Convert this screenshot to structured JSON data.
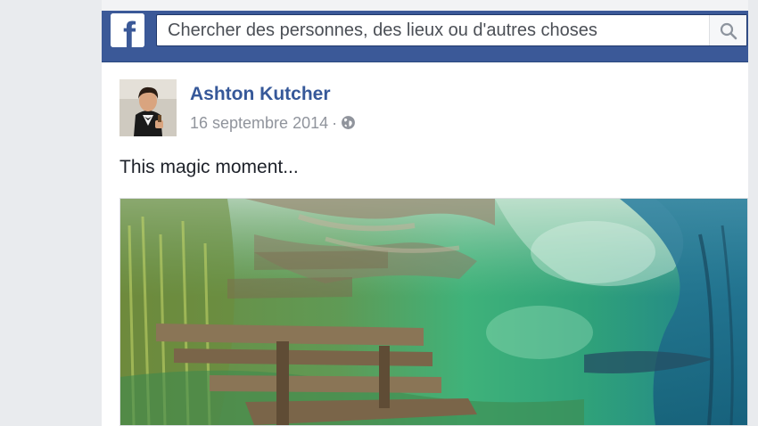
{
  "header": {
    "logo_letter": "f",
    "search": {
      "placeholder": "Chercher des personnes, des lieux ou d'autres choses"
    }
  },
  "post": {
    "author": "Ashton Kutcher",
    "date": "16 septembre 2014",
    "separator": "·",
    "audience_icon": "globe-icon",
    "text": "This magic moment...",
    "photo_description_icon": "photo"
  },
  "colors": {
    "brand_blue": "#3b5998",
    "link_blue": "#365899",
    "meta_gray": "#90949c",
    "text_dark": "#1d2129"
  }
}
